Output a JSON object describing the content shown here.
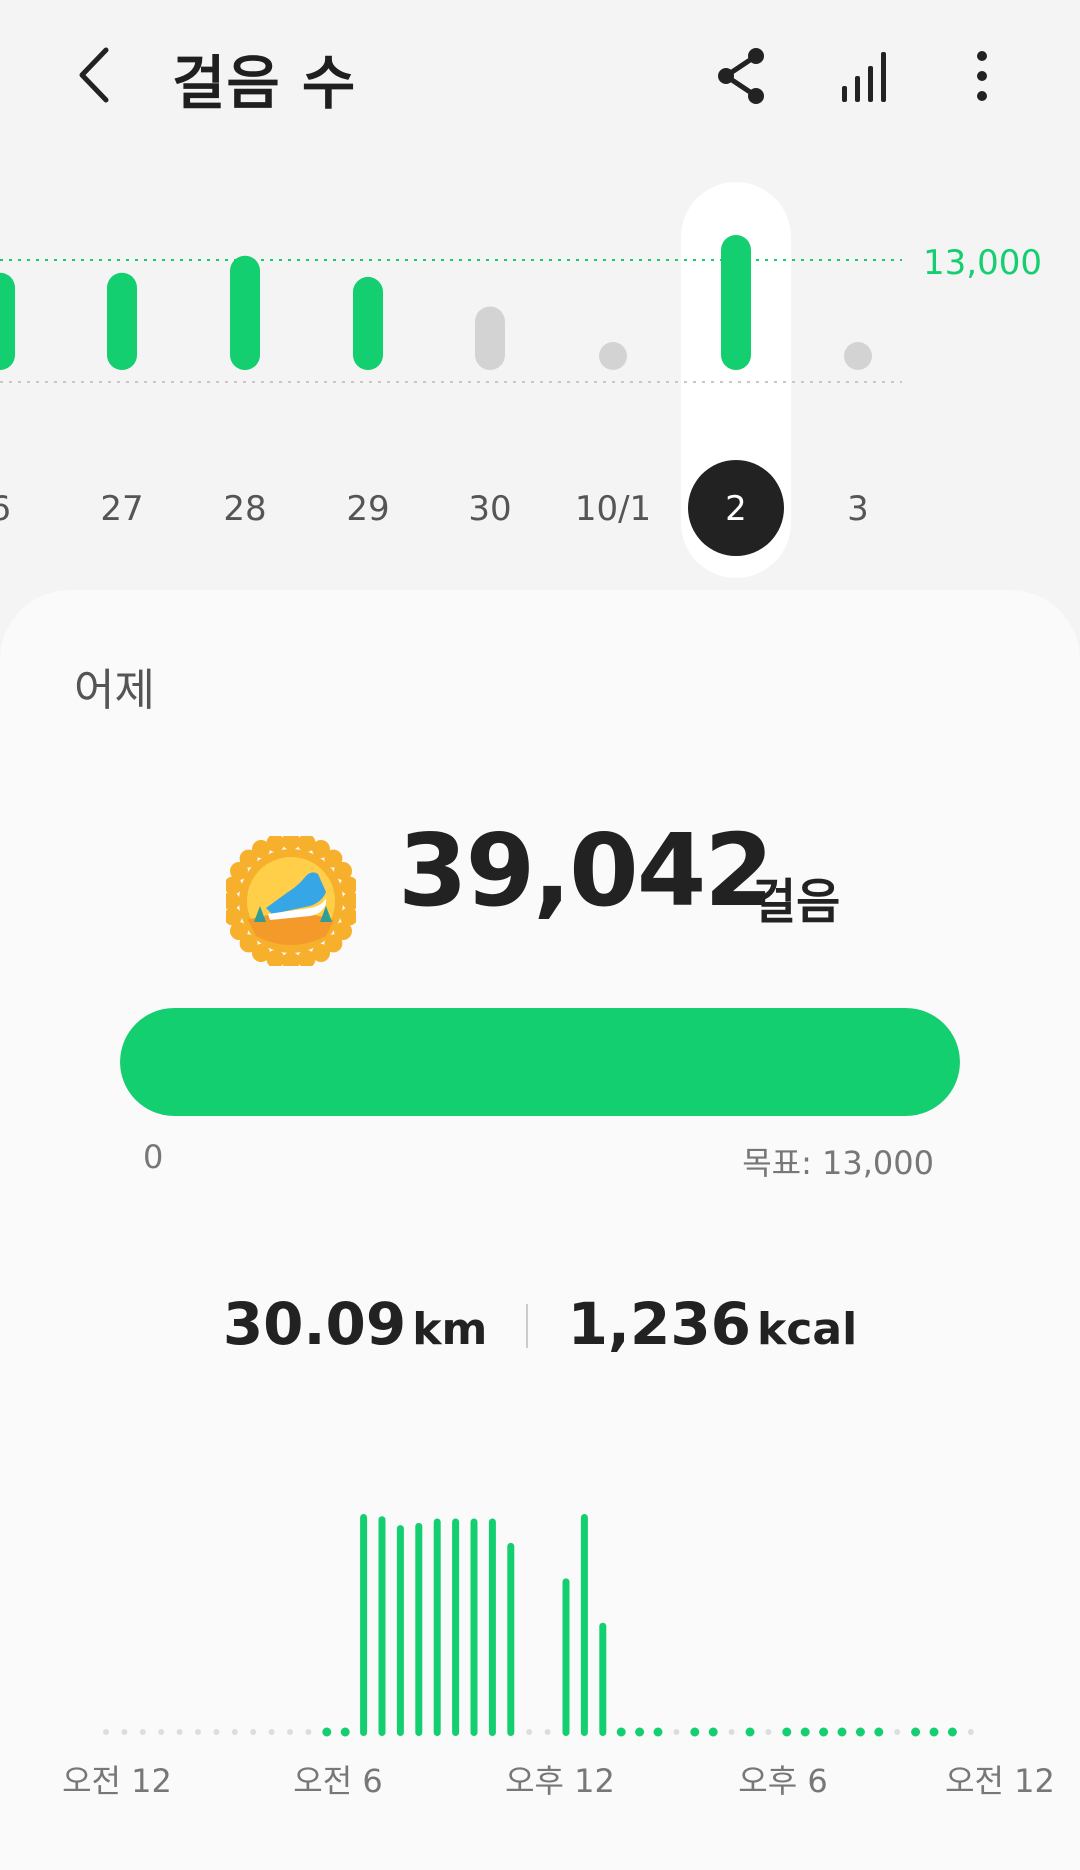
{
  "header": {
    "title": "걸음 수",
    "icons": [
      "back-arrow-icon",
      "share-icon",
      "stats-bars-icon",
      "more-vert-icon"
    ]
  },
  "daily_chart": {
    "goal_label": "13,000",
    "goal": 13000,
    "days": [
      {
        "label": "6",
        "steps": 11500,
        "active": true,
        "selected": false
      },
      {
        "label": "27",
        "steps": 11500,
        "active": true,
        "selected": false
      },
      {
        "label": "28",
        "steps": 13500,
        "active": true,
        "selected": false
      },
      {
        "label": "29",
        "steps": 11000,
        "active": true,
        "selected": false
      },
      {
        "label": "30",
        "steps": 7500,
        "active": false,
        "selected": false
      },
      {
        "label": "10/1",
        "steps": 0,
        "active": false,
        "selected": false
      },
      {
        "label": "2",
        "steps": 39042,
        "active": true,
        "selected": true
      },
      {
        "label": "3",
        "steps": 0,
        "active": false,
        "selected": false
      }
    ]
  },
  "summary": {
    "period": "어제",
    "badge_icon": "running-shoe-badge-icon",
    "steps": "39,042",
    "steps_unit": "걸음",
    "progress_fraction": 1.0,
    "progress_min": "0",
    "progress_goal": "목표: 13,000",
    "distance": "30.09",
    "distance_unit": "km",
    "calories": "1,236",
    "calories_unit": "kcal"
  },
  "chart_data": {
    "type": "bar",
    "title": "",
    "x_tick_labels": [
      "오전 12",
      "오전 6",
      "오후 12",
      "오후 6",
      "오전 12"
    ],
    "xlabel": "",
    "ylabel": "",
    "categories": [
      "00:00",
      "00:30",
      "01:00",
      "01:30",
      "02:00",
      "02:30",
      "03:00",
      "03:30",
      "04:00",
      "04:30",
      "05:00",
      "05:30",
      "06:00",
      "06:30",
      "07:00",
      "07:30",
      "08:00",
      "08:30",
      "09:00",
      "09:30",
      "10:00",
      "10:30",
      "11:00",
      "11:30",
      "12:00",
      "12:30",
      "13:00",
      "13:30",
      "14:00",
      "14:30",
      "15:00",
      "15:30",
      "16:00",
      "16:30",
      "17:00",
      "17:30",
      "18:00",
      "18:30",
      "19:00",
      "19:30",
      "20:00",
      "20:30",
      "21:00",
      "21:30",
      "22:00",
      "22:30",
      "23:00",
      "23:30"
    ],
    "values": [
      0,
      0,
      0,
      0,
      0,
      0,
      0,
      0,
      0,
      0,
      0,
      0,
      1,
      2,
      100,
      99,
      95,
      96,
      98,
      98,
      98,
      98,
      87,
      0,
      0,
      71,
      100,
      51,
      1,
      1,
      1,
      0,
      1,
      1,
      0,
      1,
      0,
      1,
      1,
      1,
      1,
      1,
      1,
      0,
      1,
      1,
      1,
      0
    ],
    "ylim": [
      0,
      100
    ],
    "accent": "#14cf6f",
    "inactive": "#dddddd"
  },
  "colors": {
    "accent": "#14cf6f",
    "selected_day": "#222222",
    "inactive": "#d3d3d3"
  }
}
